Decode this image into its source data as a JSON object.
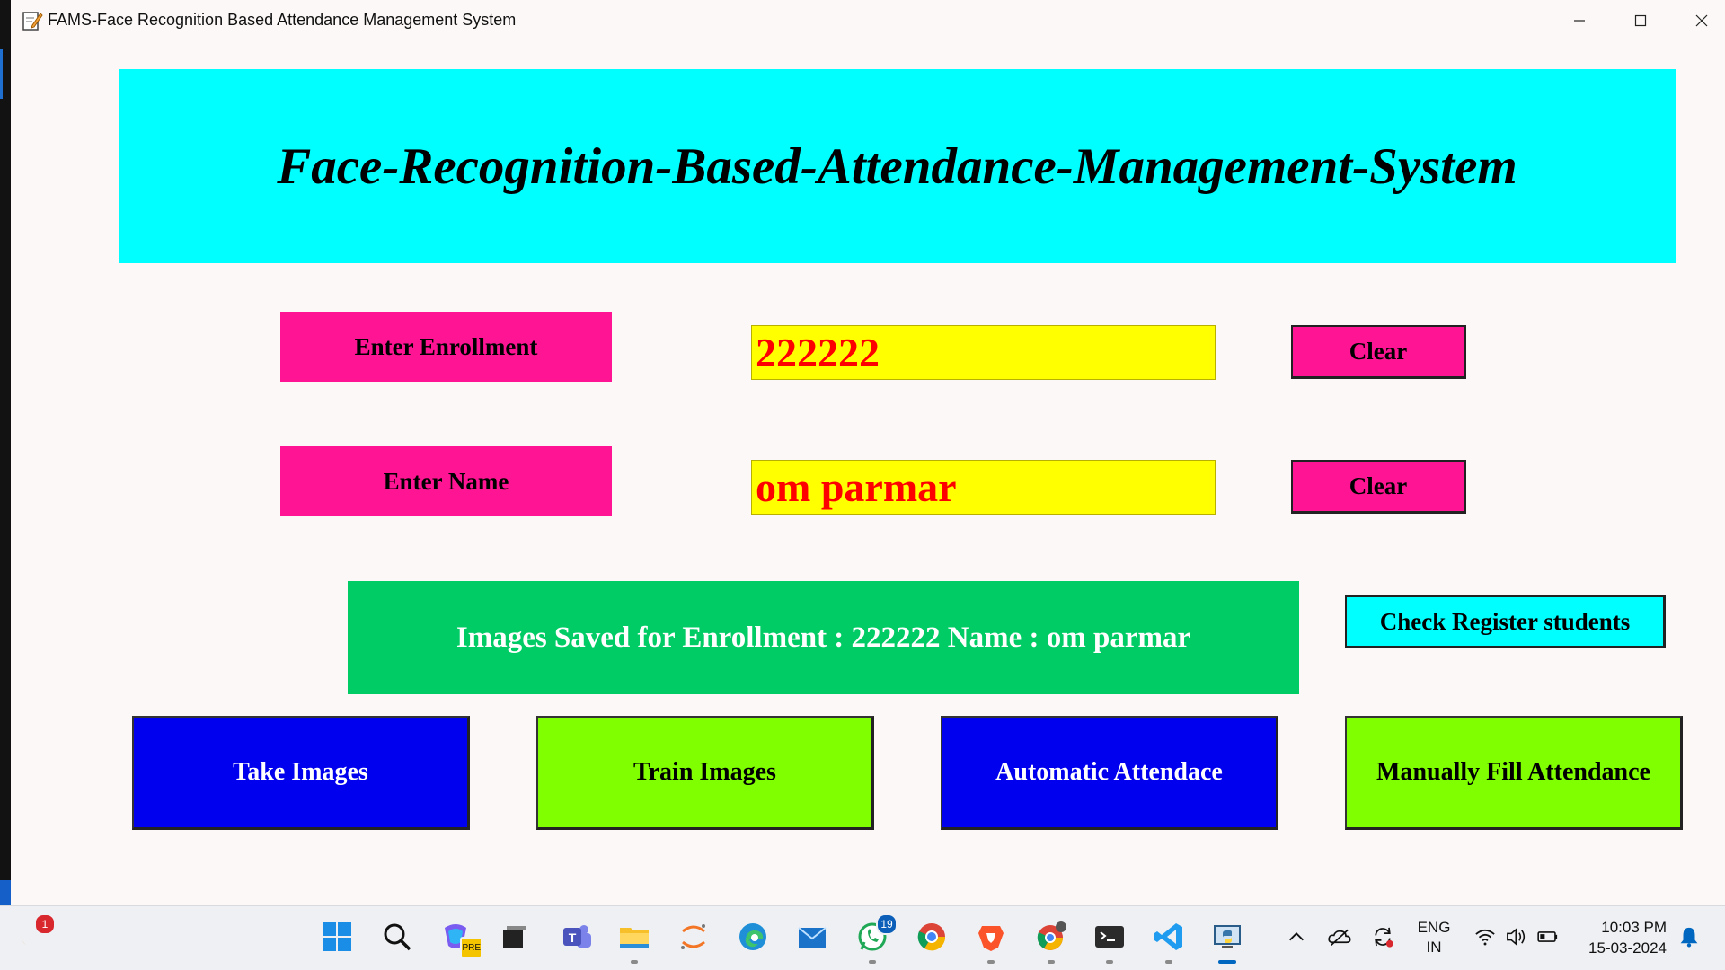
{
  "window": {
    "title": "FAMS-Face Recognition Based Attendance Management System"
  },
  "banner": {
    "title": "Face-Recognition-Based-Attendance-Management-System"
  },
  "form": {
    "enrollment_label": "Enter Enrollment",
    "enrollment_value": "222222",
    "name_label": "Enter Name",
    "name_value": "om parmar",
    "clear_label": "Clear"
  },
  "notification": {
    "text": "Images Saved for Enrollment : 222222 Name : om parmar"
  },
  "buttons": {
    "check_register": "Check Register students",
    "take_images": "Take Images",
    "train_images": "Train Images",
    "automatic_attendance": "Automatic Attendace",
    "manual_attendance": "Manually Fill Attendance"
  },
  "colors": {
    "banner": "#00ffff",
    "label_pink": "#ff1493",
    "entry_yellow": "#ffff00",
    "entry_text_red": "#ff0000",
    "notification_green": "#00cc66",
    "button_blue": "#0000ee",
    "button_lime": "#80ff00"
  },
  "taskbar": {
    "weather_badge": "1",
    "whatsapp_badge": "19",
    "copilot_badge": "PRE",
    "language_line1": "ENG",
    "language_line2": "IN",
    "time": "10:03 PM",
    "date": "15-03-2024",
    "icons": [
      "weather-icon",
      "start-icon",
      "search-icon",
      "copilot-icon",
      "task-view-icon",
      "teams-icon",
      "file-explorer-icon",
      "jupyter-icon",
      "edge-icon",
      "mail-icon",
      "whatsapp-icon",
      "chrome-icon",
      "brave-icon",
      "chrome-profile-icon",
      "terminal-icon",
      "vscode-icon",
      "python-app-icon",
      "chevron-up-icon",
      "onedrive-icon",
      "sync-icon",
      "wifi-icon",
      "volume-icon",
      "battery-icon",
      "bell-icon"
    ]
  }
}
